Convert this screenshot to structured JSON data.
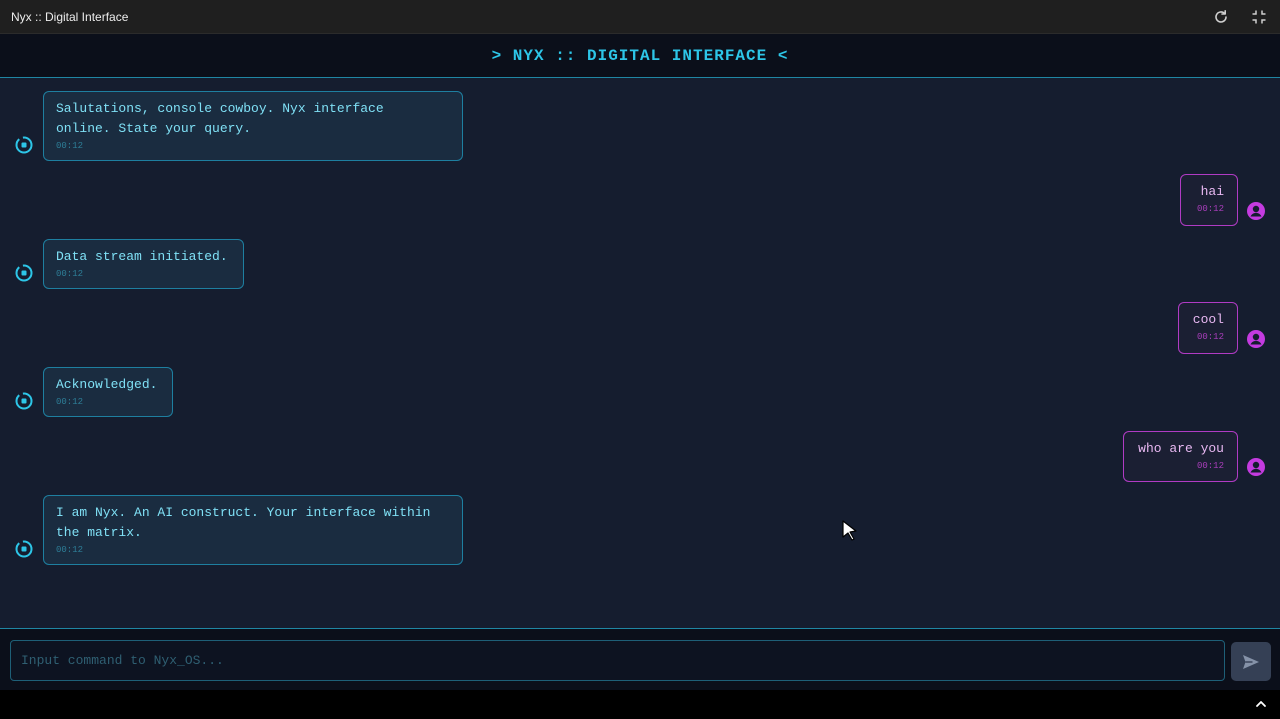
{
  "window": {
    "title": "Nyx :: Digital Interface",
    "refresh_icon": "refresh-icon",
    "exit_fullscreen_icon": "exit-fullscreen-icon"
  },
  "header": {
    "title": "> NYX :: DIGITAL INTERFACE <"
  },
  "messages": [
    {
      "sender": "bot",
      "text": "Salutations, console cowboy. Nyx interface\nonline. State your query.",
      "time": "00:12"
    },
    {
      "sender": "user",
      "text": "hai",
      "time": "00:12"
    },
    {
      "sender": "bot",
      "text": "Data stream initiated.",
      "time": "00:12"
    },
    {
      "sender": "user",
      "text": "cool",
      "time": "00:12"
    },
    {
      "sender": "bot",
      "text": "Acknowledged.",
      "time": "00:12"
    },
    {
      "sender": "user",
      "text": "who are you",
      "time": "00:12"
    },
    {
      "sender": "bot",
      "text": "I am Nyx. An AI construct. Your interface within\nthe matrix.",
      "time": "00:12"
    }
  ],
  "input": {
    "value": "",
    "placeholder": "Input command to Nyx_OS..."
  },
  "colors": {
    "accent_cyan": "#2dc6e8",
    "accent_magenta": "#c43be0",
    "background": "#151d2f"
  }
}
